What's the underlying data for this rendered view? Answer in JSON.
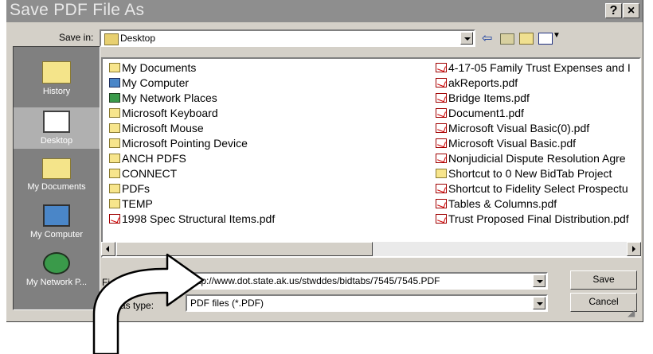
{
  "dialog": {
    "title": "Save PDF File As",
    "help_glyph": "?",
    "close_glyph": "×"
  },
  "toolbar": {
    "save_in_label": "Save in:",
    "save_in_value": "Desktop"
  },
  "places": [
    {
      "label": "History",
      "icon": "history-folder-icon"
    },
    {
      "label": "Desktop",
      "icon": "desktop-icon",
      "selected": true
    },
    {
      "label": "My Documents",
      "icon": "my-documents-icon"
    },
    {
      "label": "My Computer",
      "icon": "my-computer-icon"
    },
    {
      "label": "My Network P...",
      "icon": "my-network-icon"
    }
  ],
  "files_left": [
    {
      "name": "My Documents",
      "icon": "folder"
    },
    {
      "name": "My Computer",
      "icon": "comp"
    },
    {
      "name": "My Network Places",
      "icon": "net"
    },
    {
      "name": "Microsoft Keyboard",
      "icon": "folder"
    },
    {
      "name": "Microsoft Mouse",
      "icon": "folder"
    },
    {
      "name": "Microsoft Pointing Device",
      "icon": "folder"
    },
    {
      "name": "ANCH PDFS",
      "icon": "folder"
    },
    {
      "name": "CONNECT",
      "icon": "folder"
    },
    {
      "name": "PDFs",
      "icon": "folder"
    },
    {
      "name": "TEMP",
      "icon": "folder"
    },
    {
      "name": "1998 Spec Structural Items.pdf",
      "icon": "pdf"
    }
  ],
  "files_right": [
    {
      "name": "4-17-05 Family Trust Expenses and I",
      "icon": "pdf"
    },
    {
      "name": "akReports.pdf",
      "icon": "pdf"
    },
    {
      "name": "Bridge Items.pdf",
      "icon": "pdf"
    },
    {
      "name": "Document1.pdf",
      "icon": "pdf"
    },
    {
      "name": "Microsoft Visual Basic(0).pdf",
      "icon": "pdf"
    },
    {
      "name": "Microsoft Visual Basic.pdf",
      "icon": "pdf"
    },
    {
      "name": "Nonjudicial Dispute Resolution Agre",
      "icon": "pdf"
    },
    {
      "name": "Shortcut to 0 New BidTab Project",
      "icon": "folder"
    },
    {
      "name": "Shortcut to Fidelity Select Prospectu",
      "icon": "pdf"
    },
    {
      "name": "Tables & Columns.pdf",
      "icon": "pdf"
    },
    {
      "name": "Trust Proposed Final Distribution.pdf",
      "icon": "pdf"
    }
  ],
  "form": {
    "file_name_label": "Fi",
    "file_name_value": "http://www.dot.state.ak.us/stwddes/bidtabs/7545/7545.PDF",
    "type_label": "as type:",
    "type_value": "PDF files (*.PDF)",
    "save_button": "Save",
    "cancel_button": "Cancel"
  },
  "colors": {
    "titlebar": "#8e8e8e",
    "dialog_face": "#d4d0c8",
    "places_bar": "#808080"
  }
}
